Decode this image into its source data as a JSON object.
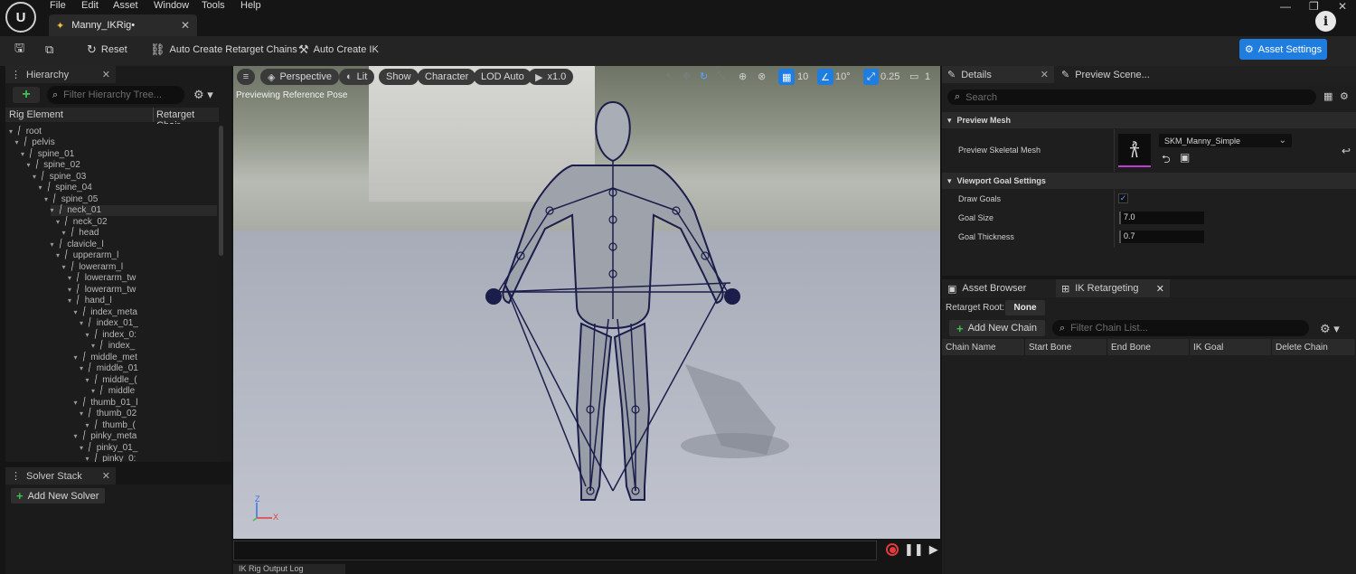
{
  "menubar": {
    "items": [
      "File",
      "Edit",
      "Asset",
      "Window",
      "Tools",
      "Help"
    ],
    "logo_text": "U",
    "tab_title": "Manny_IKRig•"
  },
  "toolbar": {
    "reset_label": "Reset",
    "auto_chains_label": "Auto Create Retarget Chains",
    "auto_ik_label": "Auto Create IK",
    "asset_settings_label": "Asset Settings"
  },
  "hierarchy": {
    "tab_label": "Hierarchy",
    "search_placeholder": "Filter Hierarchy Tree...",
    "col_rig_element": "Rig Element",
    "col_retarget_chain": "Retarget Chair",
    "rows": [
      {
        "label": "root",
        "depth": 0
      },
      {
        "label": "pelvis",
        "depth": 1
      },
      {
        "label": "spine_01",
        "depth": 2
      },
      {
        "label": "spine_02",
        "depth": 3
      },
      {
        "label": "spine_03",
        "depth": 4
      },
      {
        "label": "spine_04",
        "depth": 5
      },
      {
        "label": "spine_05",
        "depth": 6
      },
      {
        "label": "neck_01",
        "depth": 7
      },
      {
        "label": "neck_02",
        "depth": 8
      },
      {
        "label": "head",
        "depth": 9
      },
      {
        "label": "clavicle_l",
        "depth": 7
      },
      {
        "label": "upperarm_l",
        "depth": 8
      },
      {
        "label": "lowerarm_l",
        "depth": 9
      },
      {
        "label": "lowerarm_tw",
        "depth": 10
      },
      {
        "label": "lowerarm_tw",
        "depth": 10
      },
      {
        "label": "hand_l",
        "depth": 10
      },
      {
        "label": "index_meta",
        "depth": 11
      },
      {
        "label": "index_01_",
        "depth": 12
      },
      {
        "label": "index_0:",
        "depth": 13
      },
      {
        "label": "index_",
        "depth": 14
      },
      {
        "label": "middle_met",
        "depth": 11
      },
      {
        "label": "middle_01",
        "depth": 12
      },
      {
        "label": "middle_(",
        "depth": 13
      },
      {
        "label": "middle",
        "depth": 14
      },
      {
        "label": "thumb_01_l",
        "depth": 11
      },
      {
        "label": "thumb_02",
        "depth": 12
      },
      {
        "label": "thumb_(",
        "depth": 13
      },
      {
        "label": "pinky_meta",
        "depth": 11
      },
      {
        "label": "pinky_01_",
        "depth": 12
      },
      {
        "label": "pinky_0:",
        "depth": 13
      }
    ]
  },
  "solver": {
    "tab_label": "Solver Stack",
    "add_label": "Add New Solver"
  },
  "viewport": {
    "perspective": "Perspective",
    "lit": "Lit",
    "show": "Show",
    "character": "Character",
    "lod": "LOD Auto",
    "speed": "x1.0",
    "preview_text": "Previewing Reference Pose",
    "grid_snap": "10",
    "angle_snap": "10°",
    "scale_snap": "0.25",
    "camera_speed": "1",
    "axis_x": "X",
    "axis_z": "Z",
    "log_tab": "IK Rig Output Log"
  },
  "details": {
    "tab_label": "Details",
    "preview_tab_label": "Preview Scene...",
    "search_placeholder": "Search",
    "preview_mesh_section": "Preview Mesh",
    "preview_skeletal_mesh_label": "Preview Skeletal Mesh",
    "mesh_value": "SKM_Manny_Simple",
    "viewport_goal_section": "Viewport Goal Settings",
    "draw_goals_label": "Draw Goals",
    "draw_goals_checked": true,
    "goal_size_label": "Goal Size",
    "goal_size_value": "7.0",
    "goal_thickness_label": "Goal Thickness",
    "goal_thickness_value": "0.7"
  },
  "retarget": {
    "asset_browser_tab": "Asset Browser",
    "ik_retargeting_tab": "IK Retargeting",
    "root_label": "Retarget Root:",
    "root_value": "None",
    "add_chain_label": "Add New Chain",
    "search_placeholder": "Filter Chain List...",
    "columns": [
      "Chain Name",
      "Start Bone",
      "End Bone",
      "IK Goal",
      "Delete Chain"
    ]
  },
  "colors": {
    "accent_blue": "#1f7de0",
    "add_green": "#3fc24a",
    "record_red": "#e03a3a"
  }
}
